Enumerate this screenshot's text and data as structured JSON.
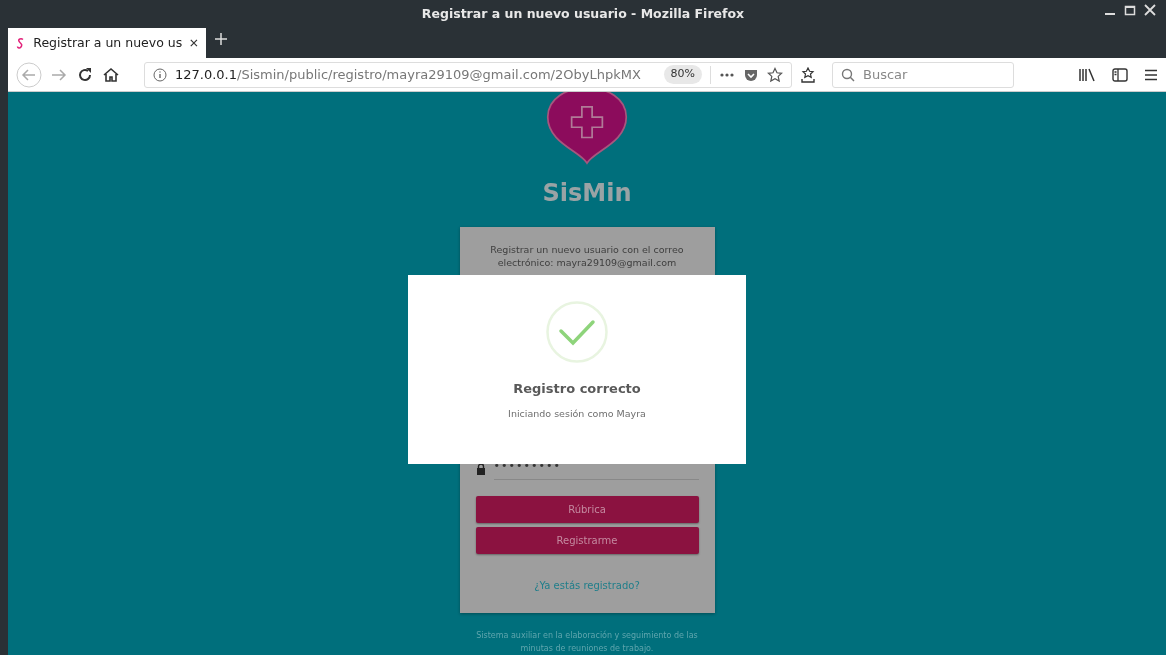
{
  "window": {
    "title": "Registrar a un nuevo usuario - Mozilla Firefox"
  },
  "tabs": [
    {
      "label": "Registrar a un nuevo us",
      "selected": true
    }
  ],
  "toolbar": {
    "url_host": "127.0.0.1",
    "url_path": "/Sismin/public/registro/mayra29109@gmail.com/2ObyLhpkMX",
    "zoom": "80%",
    "search_placeholder": "Buscar"
  },
  "page": {
    "brand": "SisMin",
    "intro": "Registrar un nuevo usuario con el correo electrónico: mayra29109@gmail.com",
    "password_value": "•••••••••",
    "buttons": [
      "Rúbrica",
      "Registrarme"
    ],
    "login_link": "¿Ya estás registrado?",
    "footer": "Sistema auxiliar en la elaboración y seguimiento de las minutas de reuniones de trabajo."
  },
  "dialog": {
    "title": "Registro correcto",
    "message": "Iniciando sesión como Mayra"
  }
}
